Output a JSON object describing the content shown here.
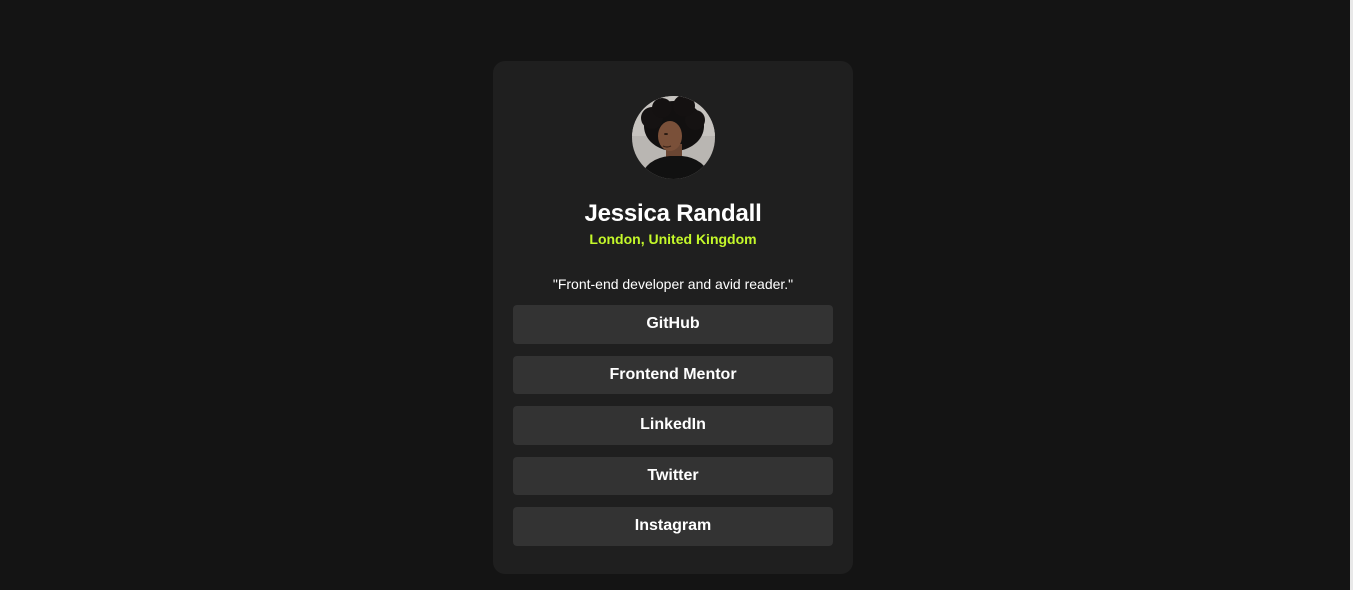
{
  "profile": {
    "name": "Jessica Randall",
    "location": "London, United Kingdom",
    "bio": "\"Front-end developer and avid reader.\""
  },
  "links": [
    {
      "label": "GitHub"
    },
    {
      "label": "Frontend Mentor"
    },
    {
      "label": "LinkedIn"
    },
    {
      "label": "Twitter"
    },
    {
      "label": "Instagram"
    }
  ],
  "colors": {
    "page_background": "#141414",
    "card_background": "#1f1f1f",
    "button_background": "#333333",
    "accent": "#c4f82a",
    "text": "#ffffff"
  }
}
